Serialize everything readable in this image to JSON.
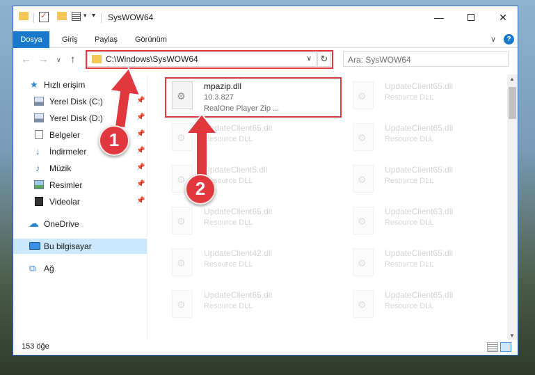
{
  "titlebar": {
    "title": "SysWOW64",
    "minimize": "—",
    "close": "✕",
    "qa_dropdown": "▾"
  },
  "ribbon": {
    "tabs": [
      "Dosya",
      "Giriş",
      "Paylaş",
      "Görünüm"
    ],
    "chevron": "∨",
    "help": "?"
  },
  "address": {
    "path": "C:\\Windows\\SysWOW64",
    "dropdown": "∨",
    "refresh": "↻",
    "search_placeholder": "Ara: SysWOW64"
  },
  "nav_buttons": {
    "back": "←",
    "forward": "→",
    "recent": "∨",
    "up": "↑"
  },
  "navpane": {
    "quick_access": "Hızlı erişim",
    "items": [
      {
        "label": "Yerel Disk (C:)",
        "icon": "drive-icon"
      },
      {
        "label": "Yerel Disk (D:)",
        "icon": "drive-icon"
      },
      {
        "label": "Belgeler",
        "icon": "documents-icon"
      },
      {
        "label": "İndirmeler",
        "icon": "downloads-icon"
      },
      {
        "label": "Müzik",
        "icon": "music-icon"
      },
      {
        "label": "Resimler",
        "icon": "pictures-icon"
      },
      {
        "label": "Videolar",
        "icon": "videos-icon"
      }
    ],
    "onedrive": "OneDrive",
    "thispc": "Bu bilgisayar",
    "network": "Ağ",
    "pin": "📌"
  },
  "files": {
    "highlighted": {
      "name": "mpazip.dll",
      "version": "10.3.827",
      "description": "RealOne Player Zip ..."
    },
    "background": [
      {
        "name": "UpdateClient65.dll",
        "description": "Resource DLL"
      },
      {
        "name": "UpdateClient65.dll",
        "description": "Resource DLL"
      },
      {
        "name": "UpdateClient65.dll",
        "description": "Resource DLL"
      },
      {
        "name": "UpdateClient5.dll",
        "description": "Resource DLL"
      },
      {
        "name": "UpdateClient65.dll",
        "description": "Resource DLL"
      },
      {
        "name": "UpdateClient65.dll",
        "description": "Resource DLL"
      },
      {
        "name": "UpdateClient63.dll",
        "description": "Resource DLL"
      },
      {
        "name": "UpdateClient42.dll",
        "description": "Resource DLL"
      },
      {
        "name": "UpdateClient65.dll",
        "description": "Resource DLL"
      },
      {
        "name": "UpdateClient65.dll",
        "description": "Resource DLL"
      },
      {
        "name": "UpdateClient65.dll",
        "description": "Resource DLL"
      }
    ]
  },
  "statusbar": {
    "count": "153 öğe"
  },
  "scrollbar": {
    "up": "▲",
    "down": "▼"
  },
  "annotations": {
    "step1": "1",
    "step2": "2",
    "color": "#e0383e"
  }
}
